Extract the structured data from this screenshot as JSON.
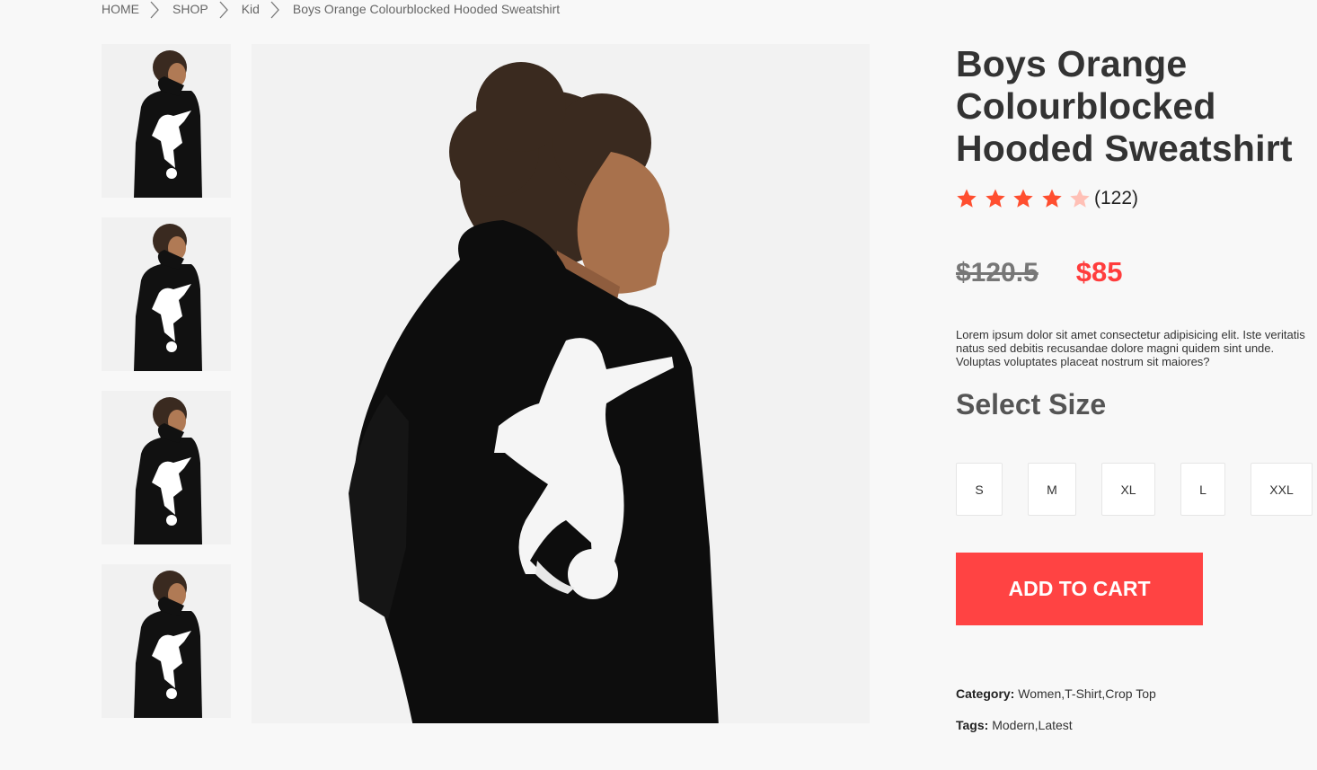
{
  "breadcrumb": [
    {
      "label": "HOME"
    },
    {
      "label": "SHOP"
    },
    {
      "label": "Kid"
    },
    {
      "label": "Boys Orange Colourblocked Hooded Sweatshirt"
    }
  ],
  "product": {
    "title_lines": [
      "Boys Orange",
      "Colourblocked",
      "Hooded Sweatshirt"
    ],
    "rating": {
      "stars": 4,
      "max": 5,
      "count": "(122)"
    },
    "old_price": "$120.5",
    "new_price": "$85",
    "description": "Lorem ipsum dolor sit amet consectetur adipisicing elit. Iste veritatis natus sed debitis recusandae dolore magni quidem sint unde. Voluptas voluptates placeat nostrum sit maiores?",
    "select_size_label": "Select Size",
    "sizes": [
      "S",
      "M",
      "XL",
      "L",
      "XXL"
    ],
    "add_to_cart": "ADD TO CART",
    "category_label": "Category:",
    "category_value": "Women,T-Shirt,Crop Top",
    "tags_label": "Tags:",
    "tags_value": "Modern,Latest"
  },
  "colors": {
    "accent": "#ff4343",
    "price": "#ff3d3d",
    "star_filled": "#ff4e2f",
    "star_empty": "#ffc0b6",
    "background": "#f8f8f8"
  },
  "images": {
    "thumbnails": [
      "product-thumbnail-1",
      "product-thumbnail-2",
      "product-thumbnail-3",
      "product-thumbnail-4"
    ],
    "main": "product-main-image"
  }
}
